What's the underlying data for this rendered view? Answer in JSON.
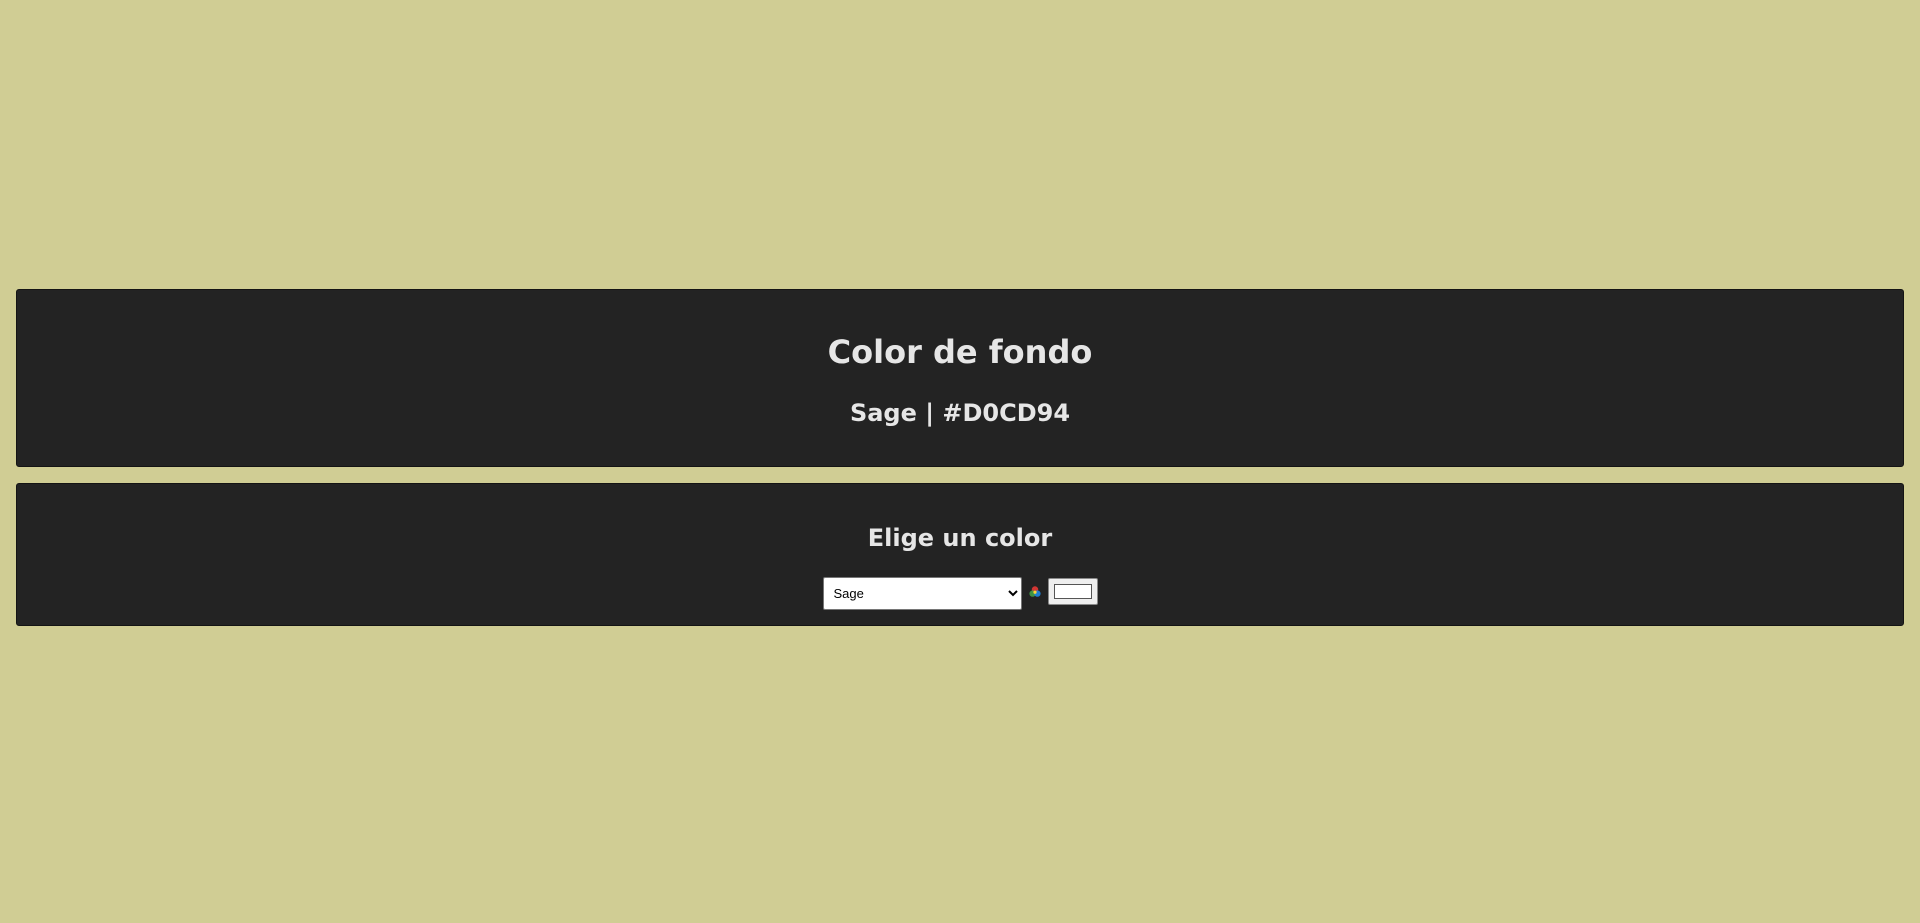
{
  "background": {
    "color": "#D0CD94",
    "title": "Color de fondo",
    "current_label": "Sage | #D0CD94"
  },
  "picker": {
    "title": "Elige un color",
    "selected_option": "Sage",
    "options": [
      "Sage"
    ],
    "wheel_icon": "color-wheel-icon",
    "swatch_color": "#FFFFFF"
  },
  "colors": {
    "panel": "#232323",
    "text": "#E6E6E6"
  }
}
